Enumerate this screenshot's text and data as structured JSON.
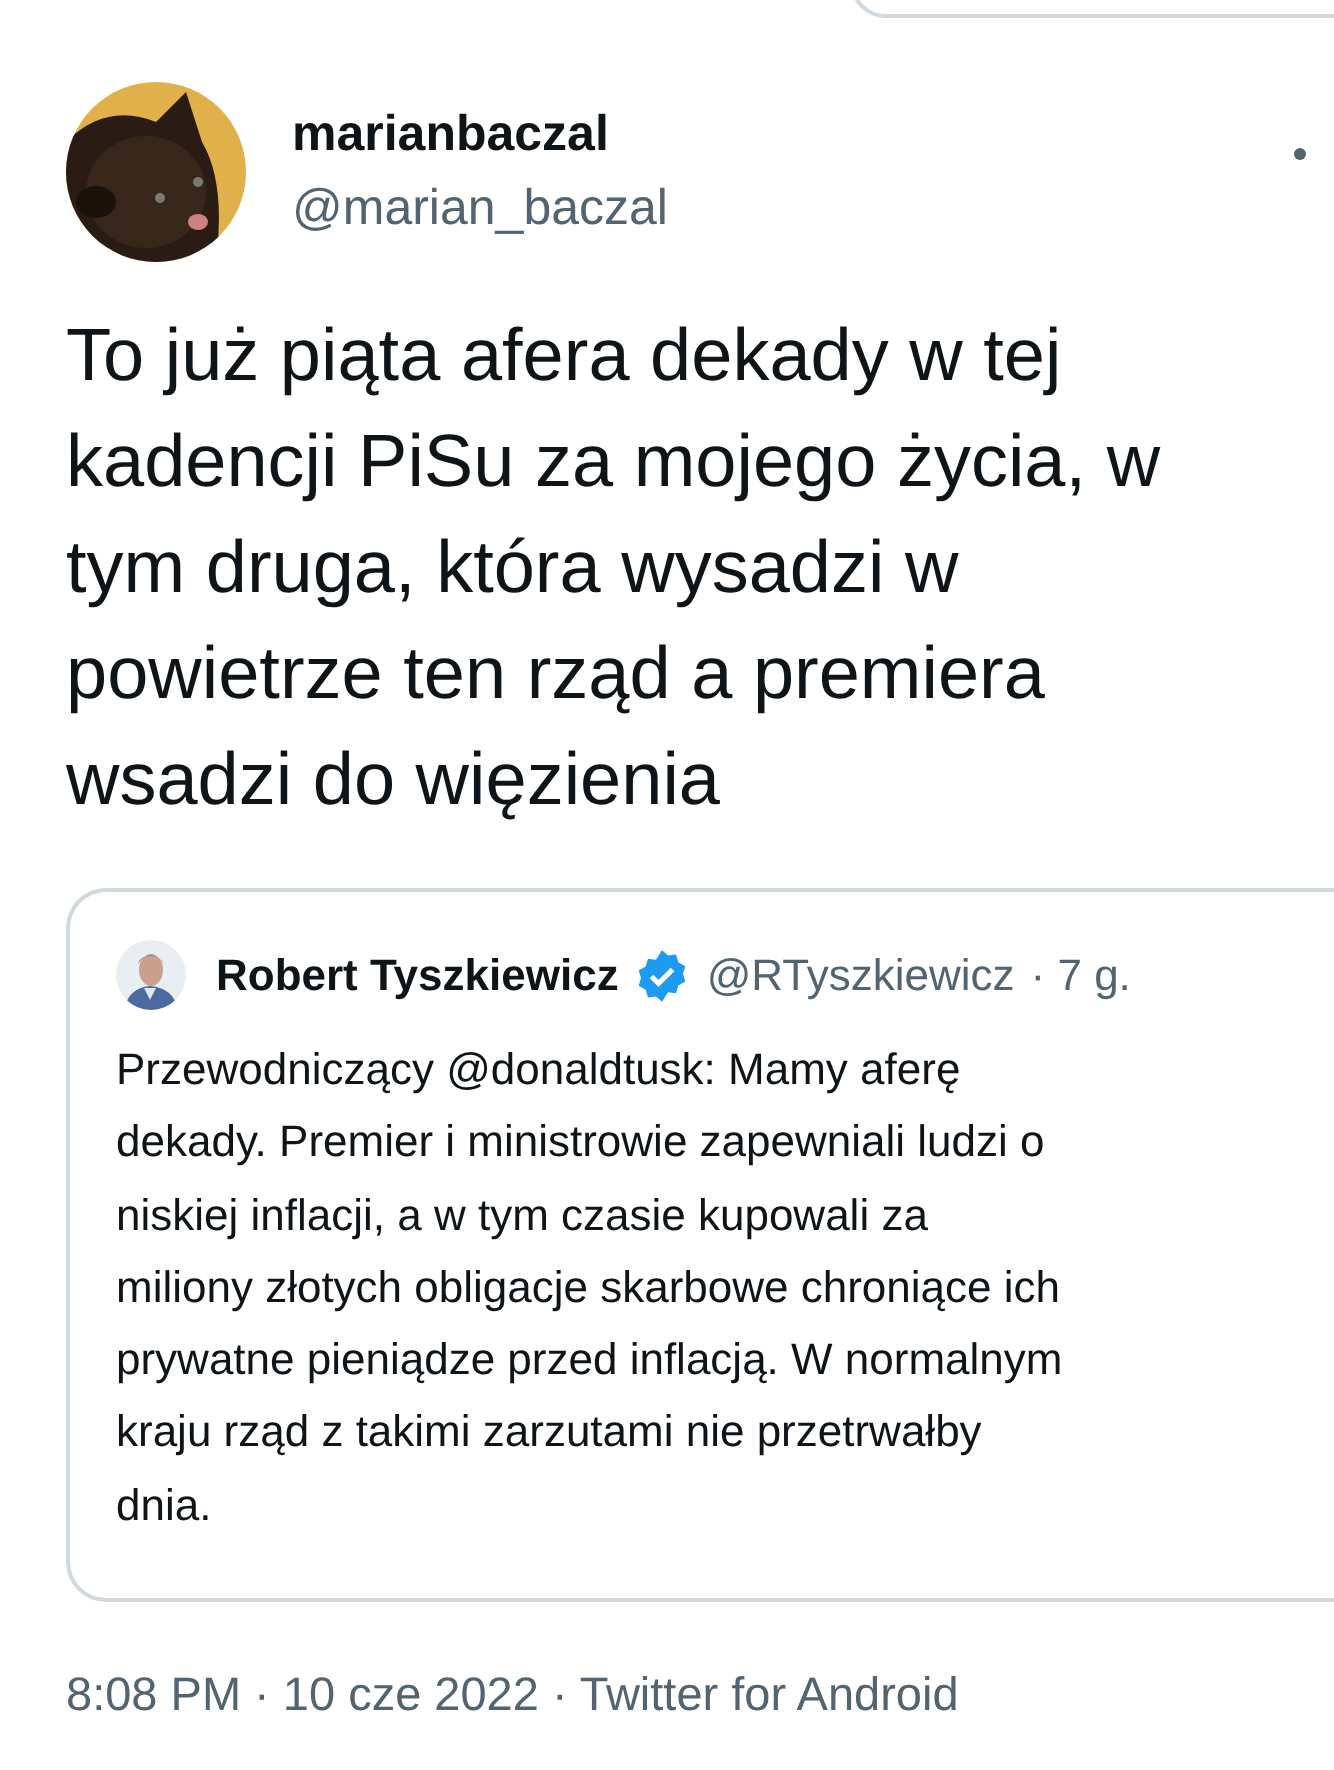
{
  "author": {
    "name": "marianbaczal",
    "handle": "@marian_baczal"
  },
  "text_lines": [
    "To już piąta afera dekady w tej",
    "kadencji PiSu za mojego życia, w",
    "tym druga, która wysadzi w",
    "powietrze ten rząd a premiera",
    "wsadzi do więzienia"
  ],
  "quote": {
    "name": "Robert Tyszkiewicz",
    "verified": true,
    "handle": "@RTyszkiewicz",
    "time": "· 7 g.",
    "text_lines": [
      "Przewodniczący @donaldtusk: Mamy aferę",
      "dekady. Premier i ministrowie zapewniali ludzi o",
      "niskiej inflacji, a w tym czasie kupowali za",
      "miliony złotych obligacje skarbowe chroniące ich",
      "prywatne pieniądze przed inflacją. W normalnym",
      "kraju rząd z takimi zarzutami nie przetrwałby",
      "dnia."
    ]
  },
  "meta": "8:08 PM · 10 cze 2022 · Twitter for Android"
}
